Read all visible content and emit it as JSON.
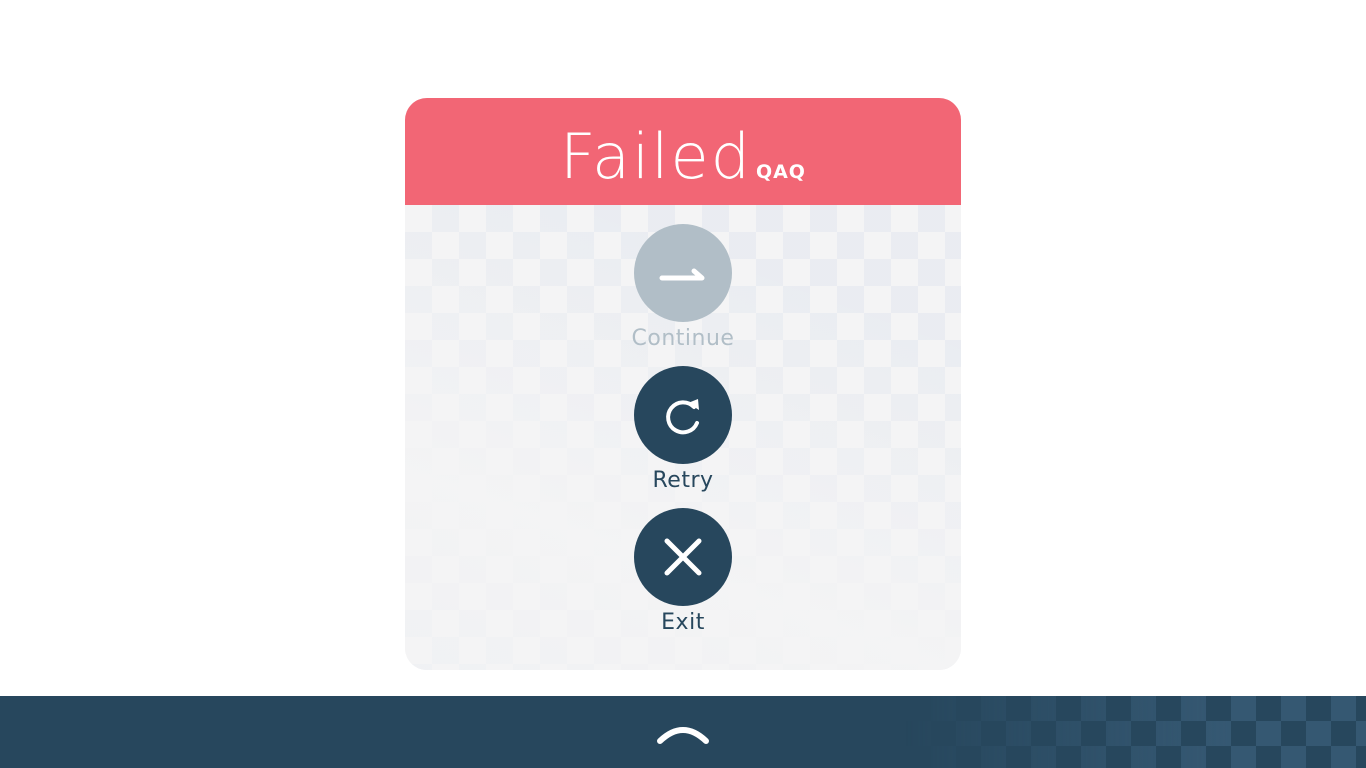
{
  "dialog": {
    "title": "Failed",
    "title_suffix": "QAQ",
    "header_color": "#f26675"
  },
  "actions": {
    "continue": {
      "label": "Continue",
      "icon": "arrow-right-icon",
      "enabled": false,
      "color": "#b1bec7"
    },
    "retry": {
      "label": "Retry",
      "icon": "restart-icon",
      "enabled": true,
      "color": "#27475d"
    },
    "exit": {
      "label": "Exit",
      "icon": "close-icon",
      "enabled": true,
      "color": "#27475d"
    }
  },
  "bottom_bar": {
    "icon": "chevron-up-icon",
    "color": "#27475d"
  }
}
